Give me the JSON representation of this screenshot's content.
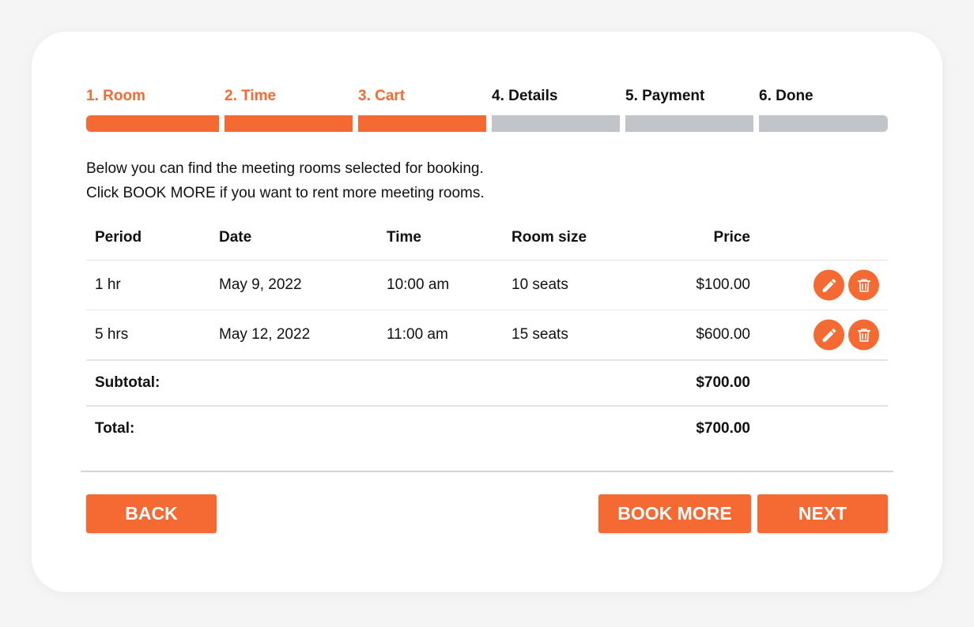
{
  "colors": {
    "accent": "#f56a32",
    "inactive_bar": "#c1c4c8",
    "text": "#111111"
  },
  "steps": [
    {
      "label": "1. Room",
      "active": true
    },
    {
      "label": "2. Time",
      "active": true
    },
    {
      "label": "3. Cart",
      "active": true
    },
    {
      "label": "4. Details",
      "active": false
    },
    {
      "label": "5. Payment",
      "active": false
    },
    {
      "label": "6. Done",
      "active": false
    }
  ],
  "intro": {
    "line1": "Below you can find the meeting rooms selected for booking.",
    "line2": "Click BOOK MORE if you want to rent more meeting rooms."
  },
  "table": {
    "headers": {
      "period": "Period",
      "date": "Date",
      "time": "Time",
      "room_size": "Room size",
      "price": "Price"
    },
    "rows": [
      {
        "period": "1 hr",
        "date": "May 9, 2022",
        "time": "10:00 am",
        "room_size": "10 seats",
        "price": "$100.00"
      },
      {
        "period": "5 hrs",
        "date": "May 12, 2022",
        "time": "11:00 am",
        "room_size": "15 seats",
        "price": "$600.00"
      }
    ],
    "row_actions": [
      "pencil-icon",
      "trash-icon"
    ],
    "subtotal_label": "Subtotal:",
    "subtotal_value": "$700.00",
    "total_label": "Total:",
    "total_value": "$700.00"
  },
  "buttons": {
    "back": "BACK",
    "book_more": "BOOK MORE",
    "next": "NEXT"
  }
}
